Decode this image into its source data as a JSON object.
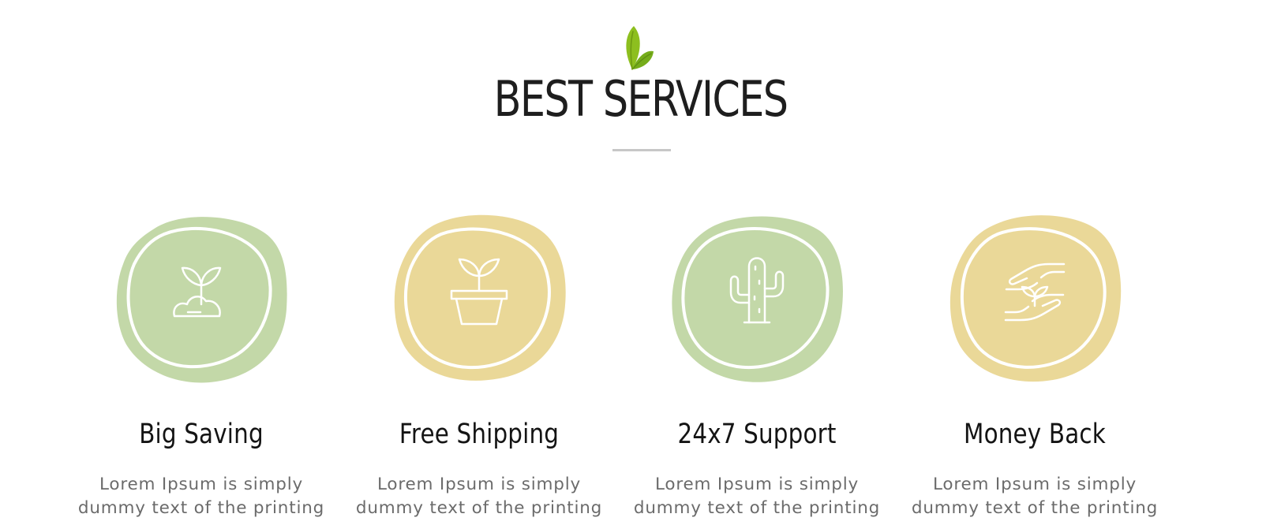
{
  "section": {
    "title": "BEST SERVICES",
    "title_icon": "leaf-icon",
    "accent_color": "#7cb518"
  },
  "services": [
    {
      "title": "Big Saving",
      "text_line1": "Lorem Ipsum is simply",
      "text_line2": "dummy text of the printing",
      "icon": "sprout-cloud-icon",
      "badge_color": "#c3d8a8"
    },
    {
      "title": "Free Shipping",
      "text_line1": "Lorem Ipsum is simply",
      "text_line2": "dummy text of the printing",
      "icon": "potted-plant-icon",
      "badge_color": "#ead898"
    },
    {
      "title": "24x7 Support",
      "text_line1": "Lorem Ipsum is simply",
      "text_line2": "dummy text of the printing",
      "icon": "cactus-icon",
      "badge_color": "#c3d8a8"
    },
    {
      "title": "Money Back",
      "text_line1": "Lorem Ipsum is simply",
      "text_line2": "dummy text of the printing",
      "icon": "hands-plant-icon",
      "badge_color": "#ead898"
    }
  ]
}
